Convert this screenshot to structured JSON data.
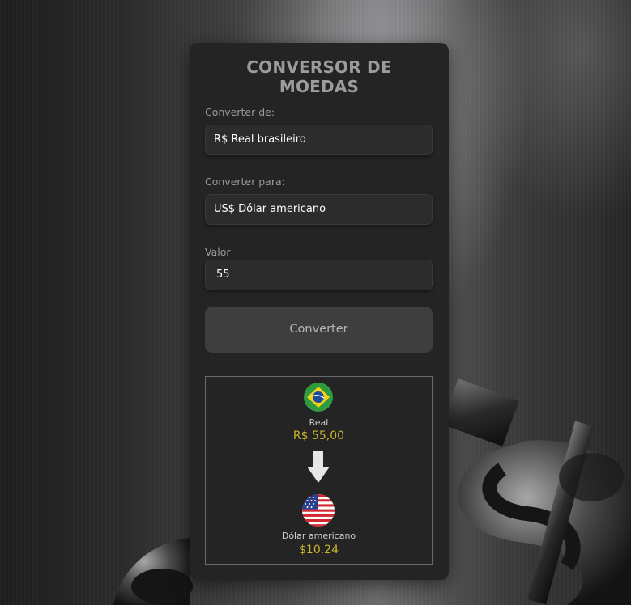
{
  "app": {
    "title": "CONVERSOR DE MOEDAS"
  },
  "form": {
    "from_label": "Converter de:",
    "from_value": "R$ Real brasileiro",
    "to_label": "Converter para:",
    "to_value": "US$ Dólar americano",
    "amount_label": "Valor",
    "amount_value": "55",
    "convert_button": "Converter"
  },
  "result": {
    "source": {
      "flag": "brazil-flag-icon",
      "name": "Real",
      "value": "R$ 55,00"
    },
    "arrow": "arrow-down-icon",
    "target": {
      "flag": "usa-flag-icon",
      "name": "Dólar americano",
      "value": "$10.24"
    }
  },
  "colors": {
    "card_bg": "#242424",
    "field_bg": "#2c2c2c",
    "button_bg": "#3e3e3e",
    "title": "#9c9c9c",
    "value_accent": "#c9b52c"
  }
}
